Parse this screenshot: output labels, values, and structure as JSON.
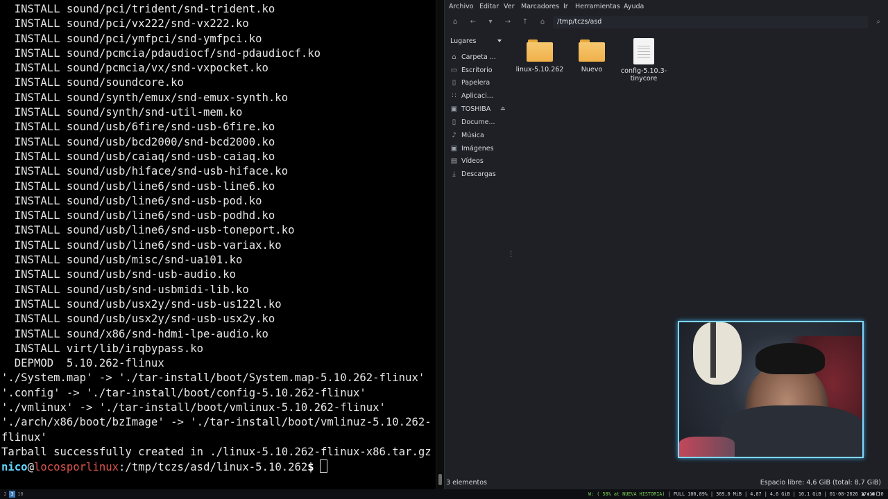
{
  "terminal": {
    "lines": [
      "  INSTALL sound/pci/trident/snd-trident.ko",
      "  INSTALL sound/pci/vx222/snd-vx222.ko",
      "  INSTALL sound/pci/ymfpci/snd-ymfpci.ko",
      "  INSTALL sound/pcmcia/pdaudiocf/snd-pdaudiocf.ko",
      "  INSTALL sound/pcmcia/vx/snd-vxpocket.ko",
      "  INSTALL sound/soundcore.ko",
      "  INSTALL sound/synth/emux/snd-emux-synth.ko",
      "  INSTALL sound/synth/snd-util-mem.ko",
      "  INSTALL sound/usb/6fire/snd-usb-6fire.ko",
      "  INSTALL sound/usb/bcd2000/snd-bcd2000.ko",
      "  INSTALL sound/usb/caiaq/snd-usb-caiaq.ko",
      "  INSTALL sound/usb/hiface/snd-usb-hiface.ko",
      "  INSTALL sound/usb/line6/snd-usb-line6.ko",
      "  INSTALL sound/usb/line6/snd-usb-pod.ko",
      "  INSTALL sound/usb/line6/snd-usb-podhd.ko",
      "  INSTALL sound/usb/line6/snd-usb-toneport.ko",
      "  INSTALL sound/usb/line6/snd-usb-variax.ko",
      "  INSTALL sound/usb/misc/snd-ua101.ko",
      "  INSTALL sound/usb/snd-usb-audio.ko",
      "  INSTALL sound/usb/snd-usbmidi-lib.ko",
      "  INSTALL sound/usb/usx2y/snd-usb-us122l.ko",
      "  INSTALL sound/usb/usx2y/snd-usb-usx2y.ko",
      "  INSTALL sound/x86/snd-hdmi-lpe-audio.ko",
      "  INSTALL virt/lib/irqbypass.ko",
      "  DEPMOD  5.10.262-flinux",
      "'./System.map' -> './tar-install/boot/System.map-5.10.262-flinux'",
      "'.config' -> './tar-install/boot/config-5.10.262-flinux'",
      "'./vmlinux' -> './tar-install/boot/vmlinux-5.10.262-flinux'",
      "'./arch/x86/boot/bzImage' -> './tar-install/boot/vmlinuz-5.10.262-",
      "flinux'",
      "Tarball successfully created in ./linux-5.10.262-flinux-x86.tar.gz"
    ],
    "prompt": {
      "user": "nico",
      "at": "@",
      "host": "locosporlinux",
      "path": ":/tmp/tczs/asd/linux-5.10.262",
      "dollar": "$"
    }
  },
  "filemanager": {
    "menu": [
      "Archivo",
      "Editar",
      "Ver",
      "Marcadores",
      "Ir",
      "Herramientas",
      "Ayuda"
    ],
    "location": "/tmp/tczs/asd",
    "places_header": "Lugares",
    "places": [
      {
        "label": "Carpeta ...",
        "icon": "home-icon"
      },
      {
        "label": "Escritorio",
        "icon": "desktop-icon"
      },
      {
        "label": "Papelera",
        "icon": "trash-icon"
      },
      {
        "label": "Aplicaci...",
        "icon": "apps-icon"
      },
      {
        "label": "TOSHIBA",
        "icon": "drive-icon"
      },
      {
        "label": "Docume...",
        "icon": "document-icon"
      },
      {
        "label": "Música",
        "icon": "music-icon"
      },
      {
        "label": "Imágenes",
        "icon": "pictures-icon"
      },
      {
        "label": "Vídeos",
        "icon": "videos-icon"
      },
      {
        "label": "Descargas",
        "icon": "downloads-icon"
      }
    ],
    "files": [
      {
        "name": "linux-5.10.262",
        "type": "folder"
      },
      {
        "name": "Nuevo",
        "type": "folder"
      },
      {
        "name": "config-5.10.3-tinycore",
        "type": "text-file"
      }
    ],
    "status_count": "3 elementos",
    "status_free": "Espacio libre: 4,6 GiB (total: 8,7 GiB)"
  },
  "taskbar": {
    "workspaces": [
      "2",
      "3",
      "10"
    ],
    "active_workspace": "3",
    "status_wifi": "W: ( 58% at NUEVA HISTORIA)",
    "status_rest": "FULL 100,89% | 369,0 MiB | 4,87 | 4,6 GiB | 10,1 GiB | 01-08-2026 17:13:10"
  },
  "colors": {
    "terminal_bg": "#000000",
    "prompt_user": "#5fd7ff",
    "prompt_host": "#e0554d",
    "fm_bg": "#1e2026",
    "folder": "#efb04a",
    "webcam_border": "#7fd8ff"
  }
}
